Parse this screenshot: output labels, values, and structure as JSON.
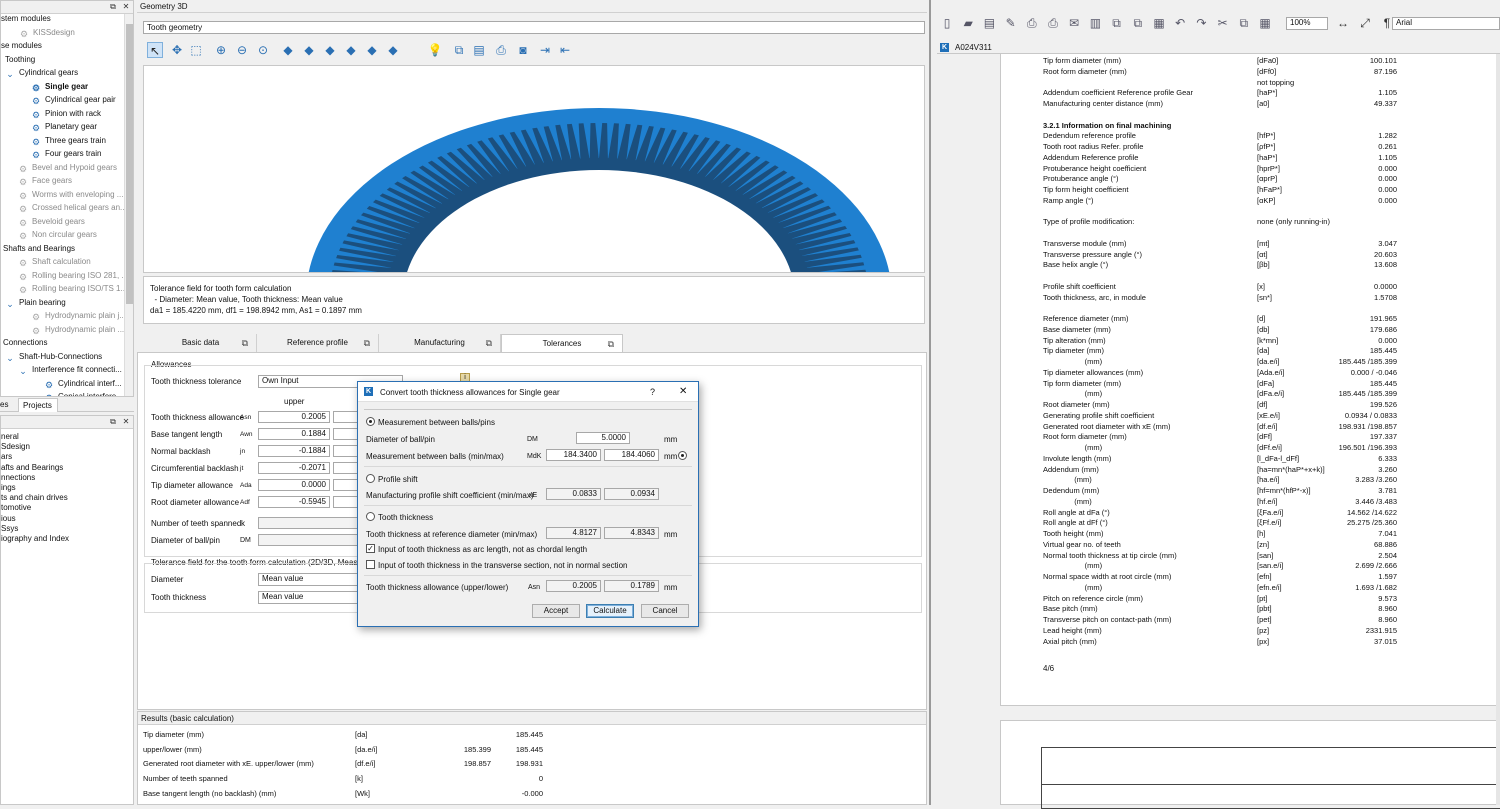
{
  "left_tree": {
    "items": [
      {
        "label": "stem modules",
        "cls": "",
        "icon": "",
        "indent": 0
      },
      {
        "label": "KISSdesign",
        "cls": "dim",
        "icon": "⚙",
        "indent": 18
      },
      {
        "label": "se modules",
        "cls": "",
        "icon": "",
        "indent": 0
      },
      {
        "label": "Toothing",
        "cls": "",
        "icon": "",
        "indent": 4
      },
      {
        "label": "Cylindrical gears",
        "cls": "",
        "icon": "⌄",
        "indent": 4
      },
      {
        "label": "Single gear",
        "cls": "bold",
        "icon": "⚙",
        "indent": 30
      },
      {
        "label": "Cylindrical gear pair",
        "cls": "",
        "icon": "⚙",
        "indent": 30
      },
      {
        "label": "Pinion with rack",
        "cls": "",
        "icon": "⚙",
        "indent": 30
      },
      {
        "label": "Planetary gear",
        "cls": "",
        "icon": "⚙",
        "indent": 30
      },
      {
        "label": "Three gears train",
        "cls": "",
        "icon": "⚙",
        "indent": 30
      },
      {
        "label": "Four gears train",
        "cls": "",
        "icon": "⚙",
        "indent": 30
      },
      {
        "label": "Bevel and Hypoid gears",
        "cls": "dim",
        "icon": "⚙",
        "indent": 17
      },
      {
        "label": "Face gears",
        "cls": "dim",
        "icon": "⚙",
        "indent": 17
      },
      {
        "label": "Worms with enveloping ...",
        "cls": "dim",
        "icon": "⚙",
        "indent": 17
      },
      {
        "label": "Crossed helical gears an...",
        "cls": "dim",
        "icon": "⚙",
        "indent": 17
      },
      {
        "label": "Beveloid gears",
        "cls": "dim",
        "icon": "⚙",
        "indent": 17
      },
      {
        "label": "Non circular gears",
        "cls": "dim",
        "icon": "⚙",
        "indent": 17
      },
      {
        "label": "Shafts and Bearings",
        "cls": "",
        "icon": "",
        "indent": 2
      },
      {
        "label": "Shaft calculation",
        "cls": "dim",
        "icon": "⚙",
        "indent": 17
      },
      {
        "label": "Rolling bearing ISO 281, ...",
        "cls": "dim",
        "icon": "⚙",
        "indent": 17
      },
      {
        "label": "Rolling bearing ISO/TS 1...",
        "cls": "dim",
        "icon": "⚙",
        "indent": 17
      },
      {
        "label": "Plain bearing",
        "cls": "",
        "icon": "⌄",
        "indent": 4
      },
      {
        "label": "Hydrodynamic plain j...",
        "cls": "dim",
        "icon": "⚙",
        "indent": 30
      },
      {
        "label": "Hydrodynamic plain ...",
        "cls": "dim",
        "icon": "⚙",
        "indent": 30
      },
      {
        "label": "Connections",
        "cls": "",
        "icon": "",
        "indent": 2
      },
      {
        "label": "Shaft-Hub-Connections",
        "cls": "",
        "icon": "⌄",
        "indent": 4
      },
      {
        "label": "Interference fit connecti...",
        "cls": "",
        "icon": "⌄",
        "indent": 17
      },
      {
        "label": "Cylindrical interf...",
        "cls": "",
        "icon": "⚙",
        "indent": 43
      },
      {
        "label": "Conical interfere...",
        "cls": "",
        "icon": "⚙",
        "indent": 43
      },
      {
        "label": "Clamped connect...",
        "cls": "",
        "icon": "⚙",
        "indent": 43
      },
      {
        "label": "Key",
        "cls": "",
        "icon": "⚙",
        "indent": 43
      }
    ],
    "tabs": [
      "es",
      "Projects"
    ],
    "lower_items": [
      "neral",
      "Sdesign",
      "ars",
      "afts and Bearings",
      "nnections",
      "ings",
      "ts and chain drives",
      "tomotive",
      "ious",
      "Ssys",
      "iography and Index"
    ]
  },
  "geometry": {
    "panel_title": "Geometry 3D",
    "view_select": "Tooth geometry",
    "toolbar_icons": [
      "cursor-icon",
      "pan-icon",
      "zoom-box-icon",
      "zoom-in-icon",
      "zoom-out-icon",
      "zoom-fit-icon",
      "view-iso-1-icon",
      "view-iso-2-icon",
      "view-iso-3-icon",
      "view-iso-4-icon",
      "view-iso-5-icon",
      "view-iso-6-icon",
      "light-icon",
      "copy-icon",
      "save-icon",
      "print-icon",
      "camera-icon",
      "export-icon",
      "import-icon"
    ],
    "gear_colors": {
      "outer": "#1f80d0",
      "teeth": "#1b4f7e"
    },
    "info_lines": [
      "Tolerance field for tooth form calculation",
      "  - Diameter: Mean value, Tooth thickness: Mean value",
      "da1 = 185.4220 mm, df1 = 198.8942 mm, As1 = 0.1897 mm"
    ]
  },
  "tabs": [
    "Basic data",
    "Reference profile",
    "Manufacturing",
    "Tolerances"
  ],
  "tolerances": {
    "group_title": "Allowances",
    "tooth_thickness_tolerance_label": "Tooth thickness tolerance",
    "tooth_thickness_tolerance_value": "Own Input",
    "col_upper": "upper",
    "rows": [
      {
        "label": "Tooth thickness allowance",
        "sym": "Asn",
        "value": "0.2005"
      },
      {
        "label": "Base tangent length",
        "sym": "Awn",
        "value": "0.1884"
      },
      {
        "label": "Normal backlash",
        "sym": "jn",
        "value": "-0.1884"
      },
      {
        "label": "Circumferential backlash",
        "sym": "jt",
        "value": "-0.2071"
      },
      {
        "label": "Tip diameter allowance",
        "sym": "Ada",
        "value": "0.0000"
      },
      {
        "label": "Root diameter allowance",
        "sym": "Adf",
        "value": "-0.5945"
      }
    ],
    "teeth_spanned_label": "Number of teeth spanned",
    "teeth_spanned_sym": "k",
    "ball_diameter_label": "Diameter of ball/pin",
    "ball_diameter_sym": "DM",
    "group2_title": "Tolerance field for the tooth form calculation (2D/3D, Measurem",
    "diameter_label": "Diameter",
    "diameter_value": "Mean value",
    "tooth_thickness_label": "Tooth thickness",
    "tooth_thickness_value": "Mean value"
  },
  "dialog": {
    "title": "Convert tooth thickness allowances for Single gear",
    "help": "?",
    "close": "✕",
    "opt1": "Measurement between balls/pins",
    "ball_label": "Diameter of ball/pin",
    "ball_sym": "DM",
    "ball_value": "5.0000",
    "unit_mm": "mm",
    "mdk_label": "Measurement between balls (min/max)",
    "mdk_sym": "MdK",
    "mdk_min": "184.3400",
    "mdk_max": "184.4060",
    "opt2": "Profile shift",
    "shift_label": "Manufacturing profile shift coefficient (min/max)",
    "shift_sym": "xE",
    "shift_min": "0.0833",
    "shift_max": "0.0934",
    "opt3": "Tooth thickness",
    "tt_label": "Tooth thickness at reference diameter (min/max)",
    "tt_min": "4.8127",
    "tt_max": "4.8343",
    "chk1": "Input of tooth thickness as arc length, not as chordal length",
    "chk2": "Input of tooth thickness in the transverse section, not in normal section",
    "allow_label": "Tooth thickness allowance (upper/lower)",
    "allow_sym": "Asn",
    "allow_upper": "0.2005",
    "allow_lower": "0.1789",
    "btn_accept": "Accept",
    "btn_calculate": "Calculate",
    "btn_cancel": "Cancel"
  },
  "results": {
    "title": "Results (basic calculation)",
    "rows": [
      {
        "label": "Tip diameter (mm)",
        "sym": "[da]",
        "v1": "",
        "v2": "185.445"
      },
      {
        "label": "upper/lower (mm)",
        "sym": "[da.e/i]",
        "v1": "185.399",
        "v2": "185.445"
      },
      {
        "label": "Generated root diameter with xE. upper/lower (mm)",
        "sym": "[df.e/i]",
        "v1": "198.857",
        "v2": "198.931"
      },
      {
        "label": "Number of teeth spanned",
        "sym": "[k]",
        "v1": "",
        "v2": "0"
      },
      {
        "label": "Base tangent length (no backlash) (mm)",
        "sym": "[Wk]",
        "v1": "",
        "v2": "-0.000"
      }
    ]
  },
  "report": {
    "font": "Arial",
    "zoom": "100%",
    "doc_tab": "A024V311",
    "page_num": "4/6",
    "lines": [
      {
        "l": "Tip form diameter (mm)",
        "s": "[dFa0]",
        "v": "100.101"
      },
      {
        "l": "Root form diameter (mm)",
        "s": "[dFf0]",
        "v": "87.196"
      },
      {
        "l": "",
        "s": "not topping",
        "v": ""
      },
      {
        "l": "Addendum coefficient Reference profile Gear",
        "s": "[haP*]",
        "v": "1.105"
      },
      {
        "l": "Manufacturing center distance (mm)",
        "s": "[a0]",
        "v": "49.337"
      },
      {
        "l": "",
        "s": "",
        "v": ""
      },
      {
        "l": "3.2.1 Information on final machining",
        "s": "",
        "v": "",
        "b": true
      },
      {
        "l": "Dedendum reference profile",
        "s": "[hfP*]",
        "v": "1.282"
      },
      {
        "l": "Tooth root radius Refer. profile",
        "s": "[ρfP*]",
        "v": "0.261"
      },
      {
        "l": "Addendum Reference profile",
        "s": "[haP*]",
        "v": "1.105"
      },
      {
        "l": "Protuberance height coefficient",
        "s": "[hprP*]",
        "v": "0.000"
      },
      {
        "l": "Protuberance angle (°)",
        "s": "[αprP]",
        "v": "0.000"
      },
      {
        "l": "Tip form height coefficient",
        "s": "[hFaP*]",
        "v": "0.000"
      },
      {
        "l": "Ramp angle (°)",
        "s": "[αKP]",
        "v": "0.000"
      },
      {
        "l": "",
        "s": "",
        "v": ""
      },
      {
        "l": "Type of profile modification:",
        "s": "none (only running-in)",
        "v": ""
      },
      {
        "l": "",
        "s": "",
        "v": ""
      },
      {
        "l": "Transverse module (mm)",
        "s": "[mt]",
        "v": "3.047"
      },
      {
        "l": "Transverse pressure angle (°)",
        "s": "[αt]",
        "v": "20.603"
      },
      {
        "l": "Base helix angle (°)",
        "s": "[βb]",
        "v": "13.608"
      },
      {
        "l": "",
        "s": "",
        "v": ""
      },
      {
        "l": "Profile shift coefficient",
        "s": "[x]",
        "v": "0.0000"
      },
      {
        "l": "Tooth thickness, arc, in module",
        "s": "[sn*]",
        "v": "1.5708"
      },
      {
        "l": "",
        "s": "",
        "v": ""
      },
      {
        "l": "Reference diameter (mm)",
        "s": "[d]",
        "v": "191.965"
      },
      {
        "l": "Base diameter (mm)",
        "s": "[db]",
        "v": "179.686"
      },
      {
        "l": "Tip alteration (mm)",
        "s": "[k*mn]",
        "v": "0.000"
      },
      {
        "l": "Tip diameter (mm)",
        "s": "[da]",
        "v": "185.445"
      },
      {
        "l": "                    (mm)",
        "s": "[da.e/i]",
        "v": "185.445 /185.399"
      },
      {
        "l": "Tip diameter allowances (mm)",
        "s": "[Ada.e/i]",
        "v": "0.000 / -0.046"
      },
      {
        "l": "Tip form diameter (mm)",
        "s": "[dFa]",
        "v": "185.445"
      },
      {
        "l": "                    (mm)",
        "s": "[dFa.e/i]",
        "v": "185.445 /185.399"
      },
      {
        "l": "Root diameter (mm)",
        "s": "[df]",
        "v": "199.526"
      },
      {
        "l": "Generating profile shift coefficient",
        "s": "[xE.e/i]",
        "v": "0.0934 / 0.0833"
      },
      {
        "l": "Generated root diameter with xE (mm)",
        "s": "[df.e/i]",
        "v": "198.931 /198.857"
      },
      {
        "l": "Root form diameter (mm)",
        "s": "[dFf]",
        "v": "197.337"
      },
      {
        "l": "                    (mm)",
        "s": "[dFf.e/i]",
        "v": "196.501 /196.393"
      },
      {
        "l": "Involute length (mm)",
        "s": "[l_dFa-l_dFf]",
        "v": "6.333"
      },
      {
        "l": "Addendum (mm)",
        "s": "[ha=mn*(haP*+x+k)]",
        "v": "3.260"
      },
      {
        "l": "               (mm)",
        "s": "[ha.e/i]",
        "v": "3.283 /3.260"
      },
      {
        "l": "Dedendum (mm)",
        "s": "[hf=mn*(hfP*-x)]",
        "v": "3.781"
      },
      {
        "l": "               (mm)",
        "s": "[hf.e/i]",
        "v": "3.446 /3.483"
      },
      {
        "l": "Roll angle at dFa (°)",
        "s": "[ξFa.e/i]",
        "v": "14.562 /14.622"
      },
      {
        "l": "Roll angle at dFf (°)",
        "s": "[ξFf.e/i]",
        "v": "25.275 /25.360"
      },
      {
        "l": "Tooth height (mm)",
        "s": "[h]",
        "v": "7.041"
      },
      {
        "l": "Virtual gear no. of teeth",
        "s": "[zn]",
        "v": "68.886"
      },
      {
        "l": "Normal tooth thickness at tip circle (mm)",
        "s": "[san]",
        "v": "2.504"
      },
      {
        "l": "                    (mm)",
        "s": "[san.e/i]",
        "v": "2.699 /2.666"
      },
      {
        "l": "Normal space width at root circle (mm)",
        "s": "[efn]",
        "v": "1.597"
      },
      {
        "l": "                    (mm)",
        "s": "[efn.e/i]",
        "v": "1.693 /1.682"
      },
      {
        "l": "Pitch on reference circle (mm)",
        "s": "[pt]",
        "v": "9.573"
      },
      {
        "l": "Base pitch (mm)",
        "s": "[pbt]",
        "v": "8.960"
      },
      {
        "l": "Transverse pitch on contact-path (mm)",
        "s": "[pet]",
        "v": "8.960"
      },
      {
        "l": "Lead height (mm)",
        "s": "[pz]",
        "v": "2331.915"
      },
      {
        "l": "Axial pitch (mm)",
        "s": "[px]",
        "v": "37.015"
      }
    ]
  }
}
